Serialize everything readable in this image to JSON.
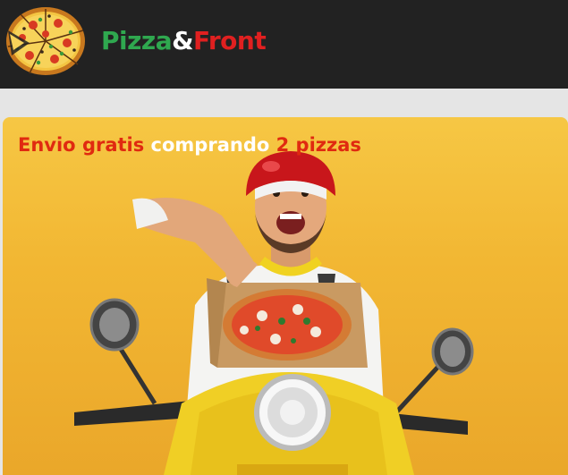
{
  "header": {
    "brand_part1": "Pizza",
    "brand_part2": "&",
    "brand_part3": "Front",
    "logo_icon": "pizza-logo",
    "colors": {
      "background": "#222222",
      "green": "#2fa84f",
      "white": "#ffffff",
      "red": "#e02020"
    }
  },
  "promo": {
    "word1": "Envio",
    "word2": "gratis",
    "word3": "comprando",
    "word4": "2",
    "word5": "pizzas",
    "colors": {
      "red": "#e02a10",
      "white": "#ffffff"
    }
  },
  "hero": {
    "image": "delivery-man-on-yellow-scooter-with-pizza",
    "background_color": "#f2b733"
  }
}
